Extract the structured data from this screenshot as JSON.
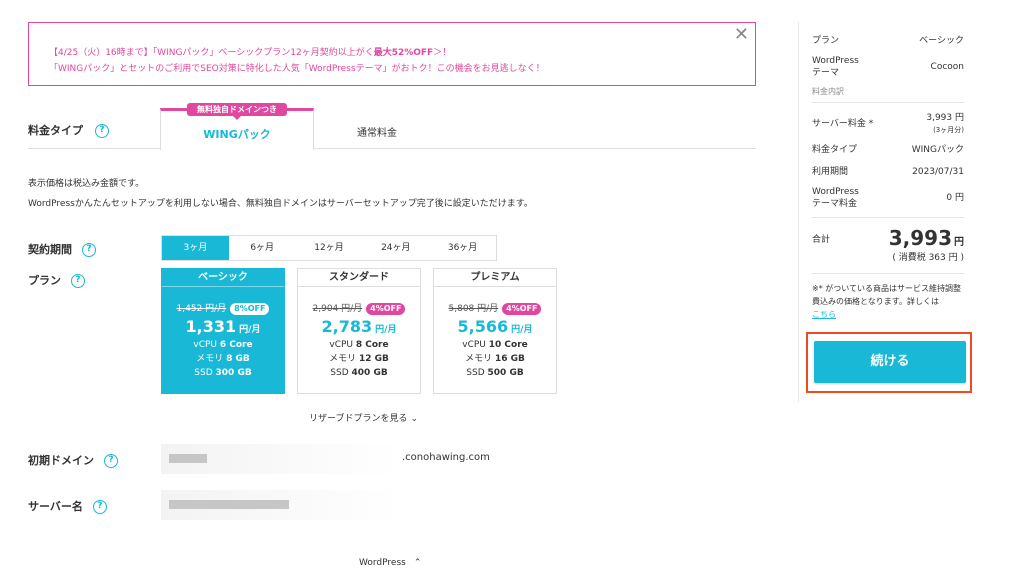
{
  "banner": {
    "line1_prefix": "【4/25（火）16時まで】「WINGパック」ベーシックプラン12ヶ月契約以上がく",
    "line1_bold": "最大52%OFF",
    "line1_suffix": "＞！",
    "line2": "「WINGパック」とセットのご利用でSEO対策に特化した人気「WordPressテーマ」がおトク！この機会をお見逃しなく！",
    "close_glyph": "✕"
  },
  "tabs": {
    "label": "料金タイプ",
    "help_glyph": "?",
    "badge": "無料独自ドメインつき",
    "active": "WINGパック",
    "normal": "通常料金"
  },
  "notes": {
    "n1": "表示価格は税込み金額です。",
    "n2": "WordPressかんたんセットアップを利用しない場合、無料独自ドメインはサーバーセットアップ完了後に設定いただけます。"
  },
  "period": {
    "label": "契約期間",
    "options": [
      "3ヶ月",
      "6ヶ月",
      "12ヶ月",
      "24ヶ月",
      "36ヶ月"
    ],
    "selected_index": 0
  },
  "plan": {
    "label": "プラン",
    "cards": [
      {
        "name": "ベーシック",
        "old": "1,452 円/月",
        "off": "8%OFF",
        "price": "1,331",
        "unit": "円/月",
        "cpu_k": "vCPU",
        "cpu_v": "6 Core",
        "mem_k": "メモリ",
        "mem_v": "8 GB",
        "ssd_k": "SSD",
        "ssd_v": "300 GB"
      },
      {
        "name": "スタンダード",
        "old": "2,904 円/月",
        "off": "4%OFF",
        "price": "2,783",
        "unit": "円/月",
        "cpu_k": "vCPU",
        "cpu_v": "8 Core",
        "mem_k": "メモリ",
        "mem_v": "12 GB",
        "ssd_k": "SSD",
        "ssd_v": "400 GB"
      },
      {
        "name": "プレミアム",
        "old": "5,808 円/月",
        "off": "4%OFF",
        "price": "5,566",
        "unit": "円/月",
        "cpu_k": "vCPU",
        "cpu_v": "10 Core",
        "mem_k": "メモリ",
        "mem_v": "16 GB",
        "ssd_k": "SSD",
        "ssd_v": "500 GB"
      }
    ],
    "reserve": "リザーブドプランを見る",
    "reserve_chev": "⌄"
  },
  "domain": {
    "label": "初期ドメイン",
    "suffix": ".conohawing.com"
  },
  "server": {
    "label": "サーバー名"
  },
  "wordpress_toggle": {
    "label": "WordPress",
    "chev": "⌃"
  },
  "summary": {
    "plan_k": "プラン",
    "plan_v": "ベーシック",
    "theme_k": "WordPress\nテーマ",
    "theme_v": "Cocoon",
    "breakdown": "料金内訳",
    "server_fee_k": "サーバー料金 *",
    "server_fee_v": "3,993 円",
    "server_fee_sub": "(3ヶ月分)",
    "type_k": "料金タイプ",
    "type_v": "WINGパック",
    "period_k": "利用期間",
    "period_v": "2023/07/31",
    "theme_fee_k": "WordPress\nテーマ料金",
    "theme_fee_v": "0 円",
    "total_k": "合計",
    "total_v": "3,993",
    "total_unit": "円",
    "tax": "( 消費税 363 円 )",
    "fine": "※* がついている商品はサービス維持調整費込みの価格となります。詳しくは",
    "fine_link": "こちら",
    "continue": "続ける"
  },
  "colors": {
    "accent": "#19b8d6",
    "pink": "#e0479e",
    "highlight": "#f04a23"
  }
}
